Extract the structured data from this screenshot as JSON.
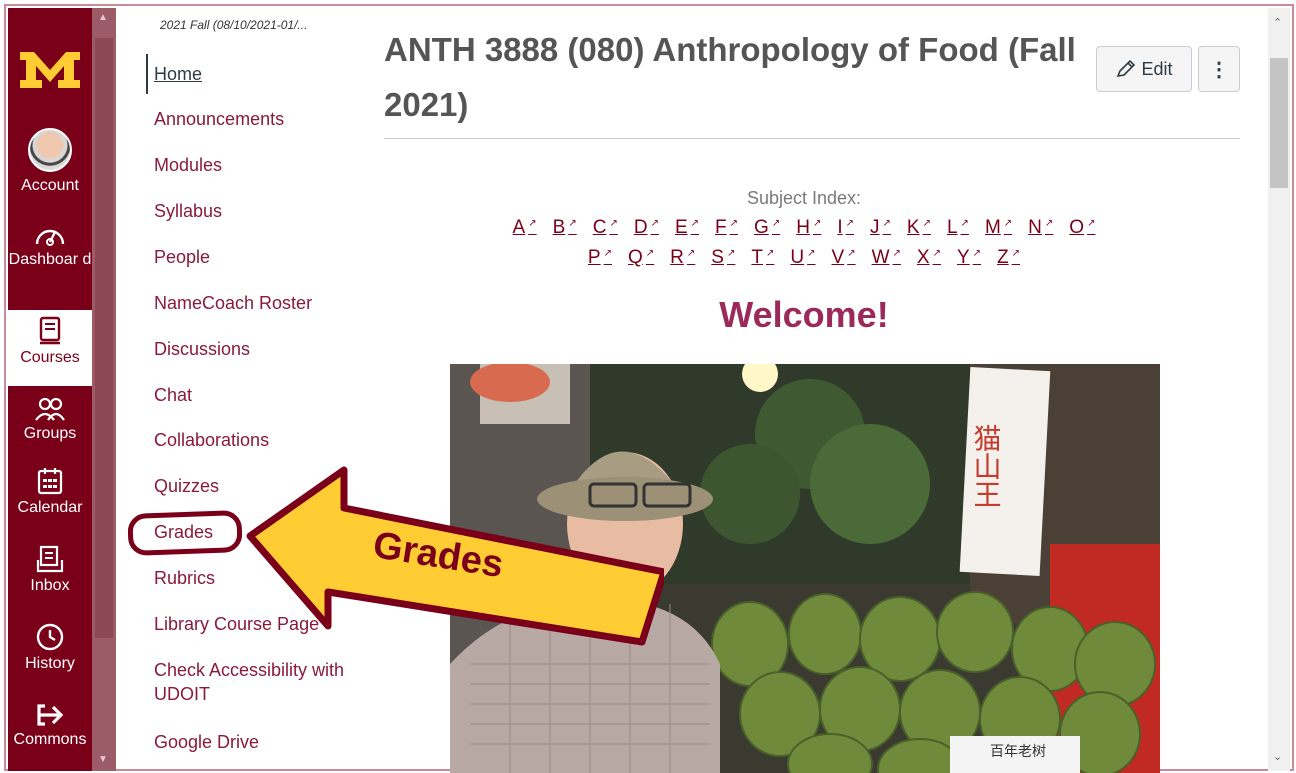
{
  "global_nav": {
    "items": [
      {
        "label": "Account"
      },
      {
        "label": "Dashboar d"
      },
      {
        "label": "Courses"
      },
      {
        "label": "Groups"
      },
      {
        "label": "Calendar"
      },
      {
        "label": "Inbox"
      },
      {
        "label": "History"
      },
      {
        "label": "Commons"
      }
    ]
  },
  "course_nav": {
    "term": "2021 Fall (08/10/2021-01/...",
    "items": [
      {
        "label": "Home"
      },
      {
        "label": "Announcements"
      },
      {
        "label": "Modules"
      },
      {
        "label": "Syllabus"
      },
      {
        "label": "People"
      },
      {
        "label": "NameCoach Roster"
      },
      {
        "label": "Discussions"
      },
      {
        "label": "Chat"
      },
      {
        "label": "Collaborations"
      },
      {
        "label": "Quizzes"
      },
      {
        "label": "Grades"
      },
      {
        "label": "Rubrics"
      },
      {
        "label": "Library Course Page"
      },
      {
        "label": "Check Accessibility with UDOIT"
      },
      {
        "label": "Google Drive"
      }
    ]
  },
  "page": {
    "title": "ANTH 3888 (080) Anthropology of Food (Fall 2021)",
    "edit_label": "Edit",
    "more_label": "⋮",
    "subject_index_label": "Subject Index:",
    "letters_row1": [
      "A",
      "B",
      "C",
      "D",
      "E",
      "F",
      "G",
      "H",
      "I",
      "J",
      "K",
      "L",
      "M",
      "N",
      "O"
    ],
    "letters_row2": [
      "P",
      "Q",
      "R",
      "S",
      "T",
      "U",
      "V",
      "W",
      "X",
      "Y",
      "Z"
    ],
    "welcome": "Welcome!",
    "sign_text_vertical": "猫山王",
    "sign_text_bottom": "百年老树"
  },
  "annotation": {
    "callout_text": "Grades"
  },
  "colors": {
    "brand_maroon": "#7a0019",
    "brand_gold": "#ffcc33",
    "link": "#8b1a3a",
    "welcome": "#9b2a5a"
  }
}
